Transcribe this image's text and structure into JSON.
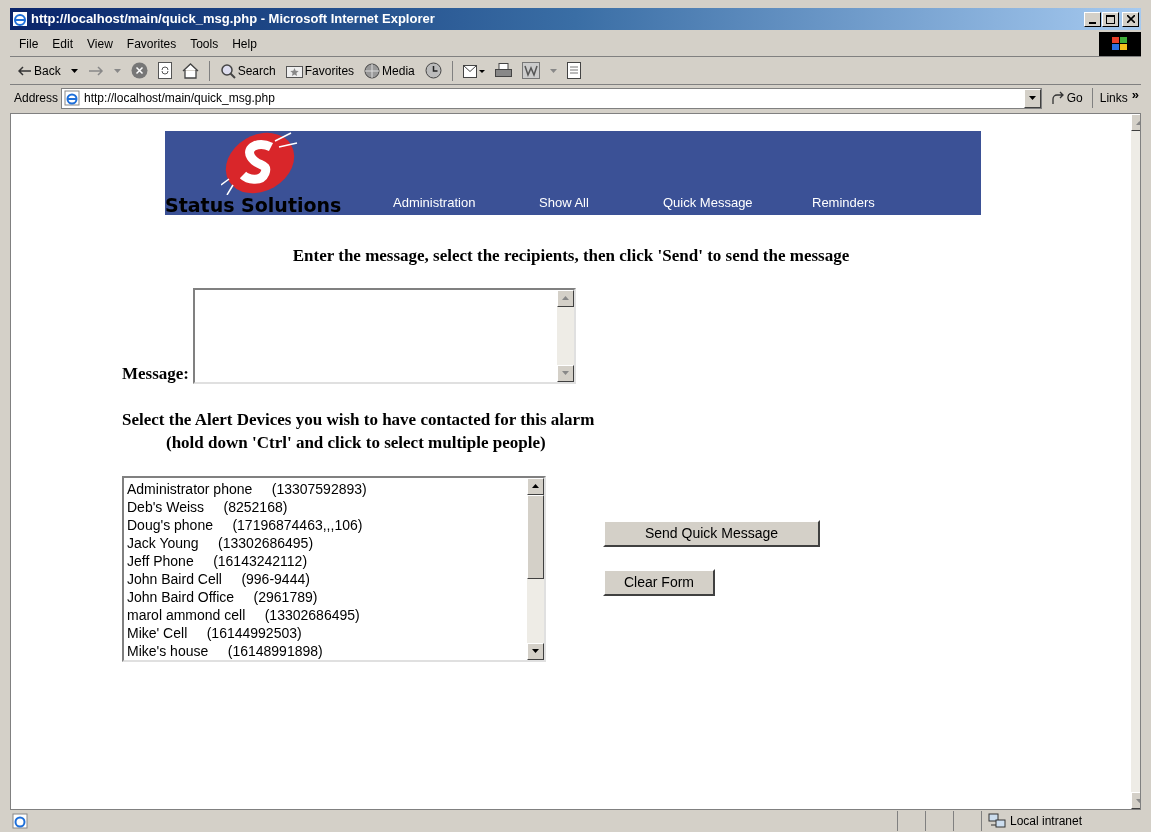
{
  "window": {
    "title": "http://localhost/main/quick_msg.php - Microsoft Internet Explorer"
  },
  "menu": [
    "File",
    "Edit",
    "View",
    "Favorites",
    "Tools",
    "Help"
  ],
  "toolbar": {
    "back": "Back",
    "search": "Search",
    "favorites": "Favorites",
    "media": "Media"
  },
  "address_bar": {
    "label": "Address",
    "url": "http://localhost/main/quick_msg.php",
    "go": "Go",
    "links": "Links",
    "links_more": "»"
  },
  "banner": {
    "logo_text": "Status Solutions",
    "nav": [
      {
        "label": "Administration"
      },
      {
        "label": "Show All"
      },
      {
        "label": "Quick Message"
      },
      {
        "label": "Reminders"
      }
    ]
  },
  "heading": "Enter the message, select the recipients, then click 'Send' to send the message",
  "message": {
    "label": "Message:"
  },
  "devices": {
    "heading": "Select the Alert Devices you wish to have contacted for this alarm",
    "hint": "(hold down 'Ctrl' and click to select multiple people)",
    "items": [
      {
        "label": "Administrator phone     (13307592893)",
        "selected": false
      },
      {
        "label": "Deb's Weiss     (8252168)",
        "selected": false
      },
      {
        "label": "Doug's phone     (17196874463,,,106)",
        "selected": false
      },
      {
        "label": "Jack Young     (13302686495)",
        "selected": false
      },
      {
        "label": "Jeff Phone     (16143242112)",
        "selected": false
      },
      {
        "label": "John Baird Cell     (996-9444)",
        "selected": false
      },
      {
        "label": "John Baird Office     (2961789)",
        "selected": false
      },
      {
        "label": "marol ammond cell     (13302686495)",
        "selected": false
      },
      {
        "label": "Mike' Cell     (16144992503)",
        "selected": false
      },
      {
        "label": "Mike's house     (16148991898)",
        "selected": false
      }
    ]
  },
  "buttons": {
    "send": "Send Quick Message",
    "clear": "Clear Form"
  },
  "status_bar": {
    "zone": "Local intranet"
  }
}
